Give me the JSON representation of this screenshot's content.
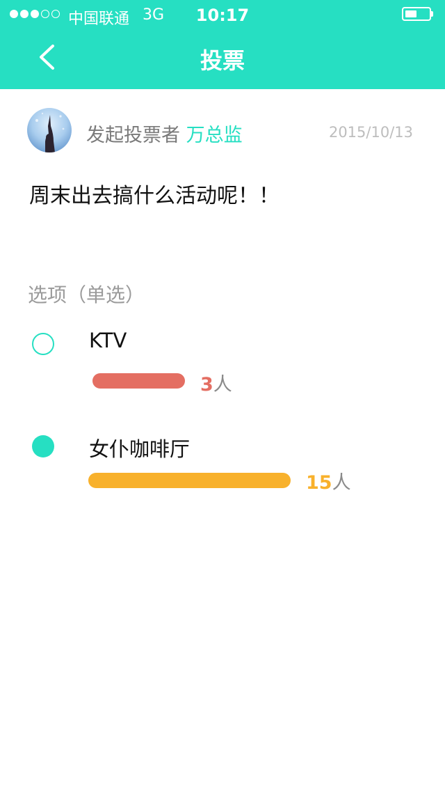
{
  "colors": {
    "accent": "#26dfc2",
    "ktv_bar": "#e46e62",
    "cafe_bar": "#f8b12c"
  },
  "status_bar": {
    "signal_filled": 3,
    "signal_total": 5,
    "carrier": "中国联通",
    "network": "3G",
    "time": "10:17",
    "battery_level": 0.5
  },
  "nav": {
    "back_icon": "chevron-left-icon",
    "title": "投票"
  },
  "vote": {
    "starter_label": "发起投票者",
    "starter_name": "万总监",
    "date": "2015/10/13",
    "question": "周末出去搞什么活动呢！！",
    "section_label": "选项（单选）",
    "options": [
      {
        "label": "KTV",
        "count": "3",
        "unit": "人",
        "selected": false
      },
      {
        "label": "女仆咖啡厅",
        "count": "15",
        "unit": "人",
        "selected": true
      }
    ]
  }
}
